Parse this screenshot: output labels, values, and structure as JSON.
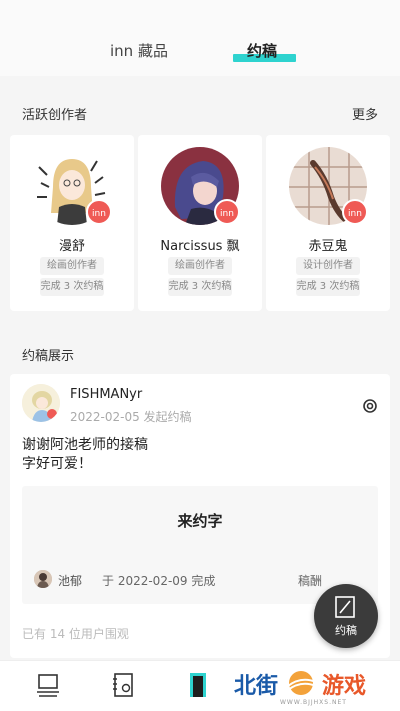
{
  "tabs": {
    "collection": "inn 藏品",
    "commission": "约稿"
  },
  "active_creators": {
    "title": "活跃创作者",
    "more": "更多",
    "items": [
      {
        "name": "漫舒",
        "role": "绘画创作者",
        "count": "完成 3 次约稿",
        "badge": "inn"
      },
      {
        "name": "Narcissus 飘",
        "role": "绘画创作者",
        "count": "完成 3 次约稿",
        "badge": "inn"
      },
      {
        "name": "赤豆鬼",
        "role": "设计创作者",
        "count": "完成 3 次约稿",
        "badge": "inn"
      }
    ]
  },
  "showcase": {
    "title": "约稿展示",
    "post": {
      "username": "FISHMANyr",
      "meta": "2022-02-05 发起约稿",
      "text_line1": "谢谢阿池老师的接稿",
      "text_line2": "字好可爱！",
      "work_title": "来约字",
      "work_author": "池郁",
      "work_complete": "于 2022-02-09 完成",
      "work_fee": "稿酬",
      "viewers": "已有 14 位用户围观"
    }
  },
  "fab": {
    "label": "约稿"
  },
  "watermark": {
    "left": "北街",
    "right": "游戏",
    "url": "WWW.BJJHXS.NET"
  },
  "colors": {
    "accent": "#2ed3cf",
    "badge": "#ef5a55"
  }
}
